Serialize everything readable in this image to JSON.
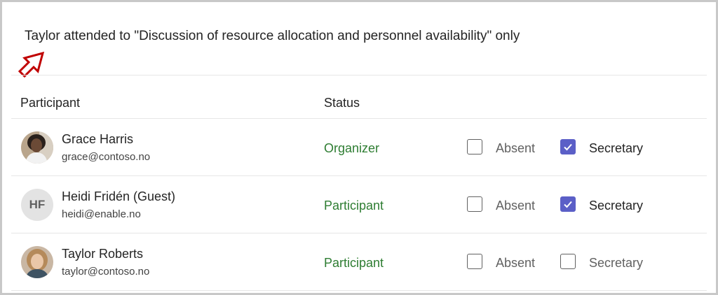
{
  "annotation": {
    "text": "Taylor attended to \"Discussion of resource allocation and personnel availability\" only",
    "arrow_icon": "arrow-up-outline-icon",
    "arrow_color": "#c00000"
  },
  "table": {
    "headers": {
      "participant": "Participant",
      "status": "Status"
    },
    "rows": [
      {
        "name": "Grace Harris",
        "email": "grace@contoso.no",
        "status": "Organizer",
        "avatar_type": "photo",
        "absent_label": "Absent",
        "absent_checked": false,
        "secretary_label": "Secretary",
        "secretary_checked": true
      },
      {
        "name": "Heidi Fridén (Guest)",
        "email": "heidi@enable.no",
        "status": "Participant",
        "avatar_type": "initials",
        "initials": "HF",
        "absent_label": "Absent",
        "absent_checked": false,
        "secretary_label": "Secretary",
        "secretary_checked": true
      },
      {
        "name": "Taylor Roberts",
        "email": "taylor@contoso.no",
        "status": "Participant",
        "avatar_type": "photo",
        "absent_label": "Absent",
        "absent_checked": false,
        "secretary_label": "Secretary",
        "secretary_checked": false
      }
    ]
  },
  "colors": {
    "status_text": "#2e7d32",
    "checkbox_checked": "#5b5fc7",
    "divider": "#e6e6e6"
  }
}
